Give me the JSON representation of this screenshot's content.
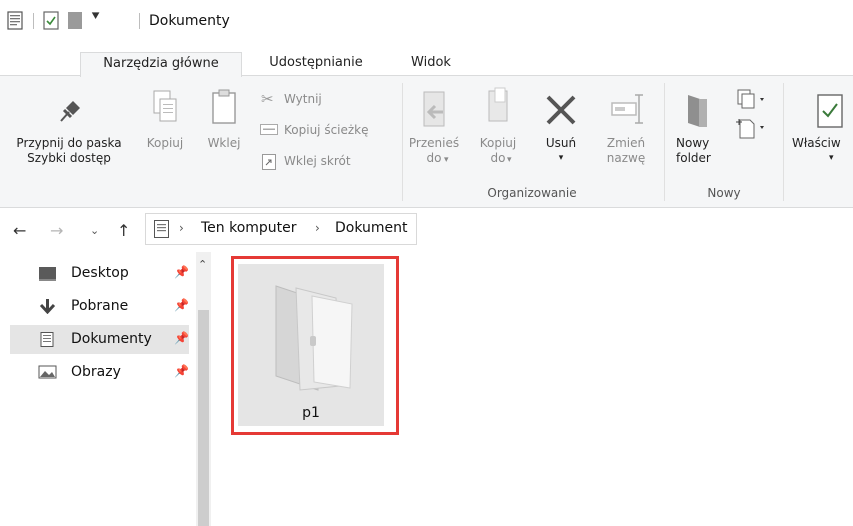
{
  "window": {
    "title": "Dokumenty"
  },
  "tabs": [
    {
      "label": "Narzędzia główne",
      "active": true
    },
    {
      "label": "Udostępnianie",
      "active": false
    },
    {
      "label": "Widok",
      "active": false
    }
  ],
  "ribbon": {
    "pin_quick_line1": "Przypnij do paska",
    "pin_quick_line2": "Szybki dostęp",
    "copy": "Kopiuj",
    "paste": "Wklej",
    "cut": "Wytnij",
    "copy_path": "Kopiuj ścieżkę",
    "paste_shortcut": "Wklej skrót",
    "move_line1": "Przenieś",
    "move_line2": "do",
    "copyto_line1": "Kopiuj",
    "copyto_line2": "do",
    "delete": "Usuń",
    "rename_line1": "Zmień",
    "rename_line2": "nazwę",
    "new_folder_line1": "Nowy",
    "new_folder_line2": "folder",
    "properties": "Właściw",
    "group_organize": "Organizowanie",
    "group_new": "Nowy"
  },
  "address": {
    "crumbs": [
      "Ten komputer",
      "Dokument"
    ]
  },
  "nav": {
    "items": [
      {
        "label": "Desktop",
        "icon": "desktop-icon"
      },
      {
        "label": "Pobrane",
        "icon": "download-icon"
      },
      {
        "label": "Dokumenty",
        "icon": "document-icon"
      },
      {
        "label": "Obrazy",
        "icon": "pictures-icon"
      }
    ]
  },
  "files": [
    {
      "name": "p1",
      "icon": "folder-icon"
    }
  ],
  "colors": {
    "selection_border": "#e53935",
    "ribbon_bg": "#f5f6f7"
  }
}
